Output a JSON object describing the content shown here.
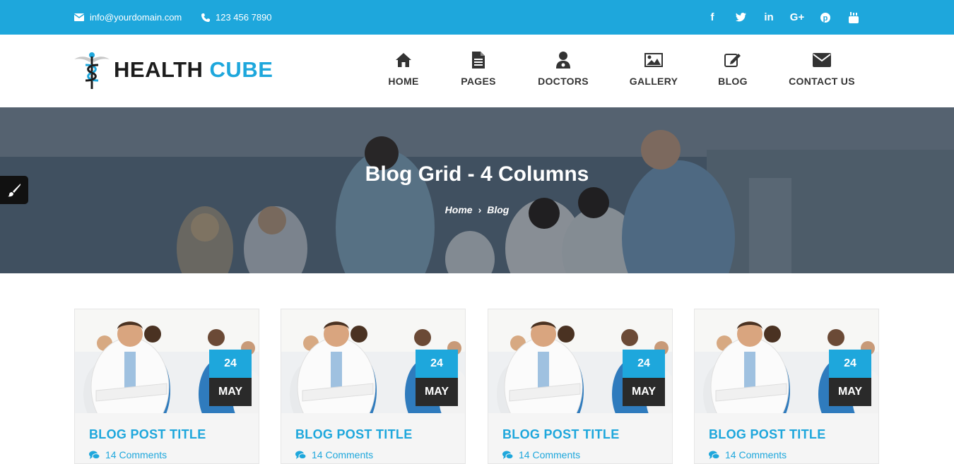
{
  "topbar": {
    "email": "info@yourdomain.com",
    "phone": "123 456 7890",
    "socials": [
      {
        "icon": "facebook-icon",
        "glyph": "f"
      },
      {
        "icon": "twitter-icon",
        "glyph": "t"
      },
      {
        "icon": "linkedin-icon",
        "glyph": "in"
      },
      {
        "icon": "google-plus-icon",
        "glyph": "G+"
      },
      {
        "icon": "pinterest-icon",
        "glyph": "p"
      },
      {
        "icon": "youtube-icon",
        "glyph": "▶"
      }
    ]
  },
  "logo": {
    "part1": "HEALTH",
    "part2": "CUBE"
  },
  "nav": [
    {
      "label": "HOME",
      "icon": "home-icon"
    },
    {
      "label": "PAGES",
      "icon": "document-icon"
    },
    {
      "label": "DOCTORS",
      "icon": "doctor-icon"
    },
    {
      "label": "GALLERY",
      "icon": "image-icon"
    },
    {
      "label": "BLOG",
      "icon": "edit-icon"
    },
    {
      "label": "CONTACT US",
      "icon": "envelope-icon"
    }
  ],
  "banner": {
    "title": "Blog Grid - 4 Columns",
    "breadcrumb": [
      "Home",
      "Blog"
    ]
  },
  "posts": [
    {
      "day": "24",
      "month": "MAY",
      "title": "BLOG POST TITLE",
      "comments": "14 Comments"
    },
    {
      "day": "24",
      "month": "MAY",
      "title": "BLOG POST TITLE",
      "comments": "14 Comments"
    },
    {
      "day": "24",
      "month": "MAY",
      "title": "BLOG POST TITLE",
      "comments": "14 Comments"
    },
    {
      "day": "24",
      "month": "MAY",
      "title": "BLOG POST TITLE",
      "comments": "14 Comments"
    }
  ],
  "colors": {
    "accent": "#1ea7dc",
    "dark": "#2a2a2a"
  }
}
